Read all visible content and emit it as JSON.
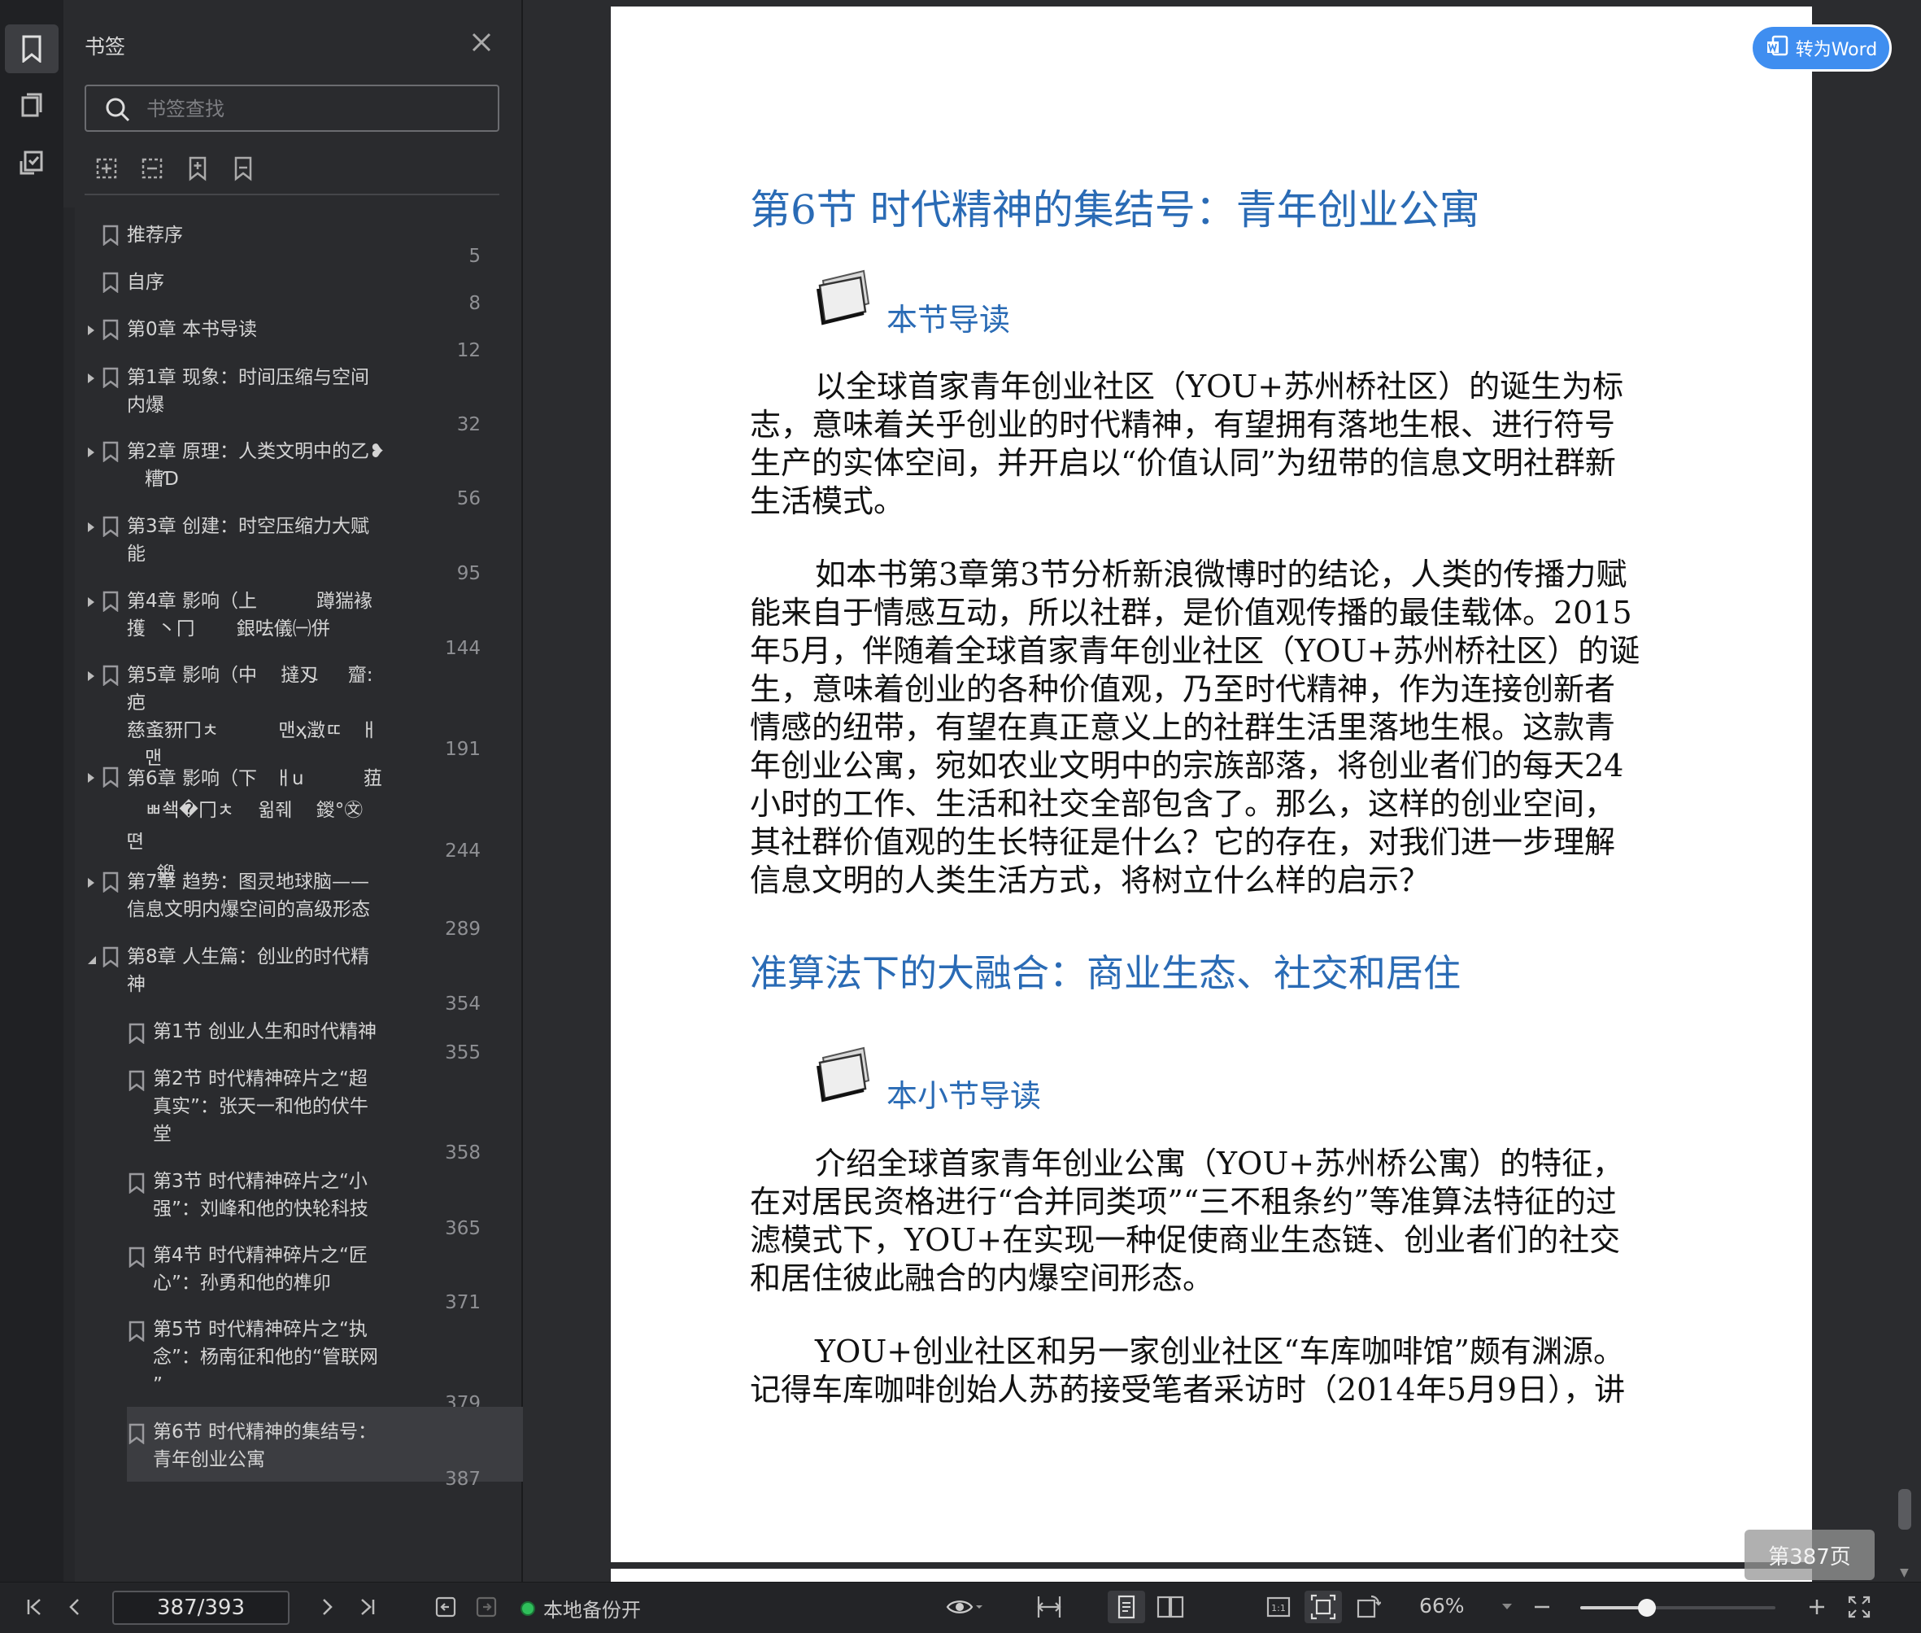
{
  "sidebar": {
    "title": "书签",
    "search_placeholder": "书签查找",
    "bookmarks": [
      {
        "label": "推荐序",
        "page": "5"
      },
      {
        "label": "自序",
        "page": "8"
      },
      {
        "label": "第0章 本书导读",
        "page": "12"
      },
      {
        "label": "第1章 现象：时间压缩与空间\n内爆",
        "page": "32"
      },
      {
        "label": "第2章 原理：人类文明中的乙❥\n   糟Ɗ",
        "page": "56"
      },
      {
        "label": "第3章 创建：时空压缩力大赋\n能",
        "page": "95"
      },
      {
        "label": "第4章 影响（上          蹲猯褖\n擭  丶冂       銀呿儀㈠併",
        "page": "144"
      },
      {
        "label": "第5章 影响（中    撻刄     齏:疤\n慈蚉豜冂ㅊ          맨ҳ澂ㄸ   ㅐ\n   맨",
        "page": "191"
      },
      {
        "label": "第6章 影响（下   ㅐu          莥\n   ㅃ쇅�冂ㅊ    윎줴    鍐°㉆    뗜\n     鍛",
        "page": "244"
      },
      {
        "label": "第7章 趋势：图灵地球脑——\n信息文明内爆空间的高级形态",
        "page": "289"
      },
      {
        "label": "第8章 人生篇：创业的时代精\n神",
        "page": "354"
      },
      {
        "label": "第1节 创业人生和时代精神",
        "page": "355"
      },
      {
        "label": "第2节 时代精神碎片之“超\n真实”：张天一和他的伏牛\n堂",
        "page": "358"
      },
      {
        "label": "第3节 时代精神碎片之“小\n强”：刘峰和他的快轮科技",
        "page": "365"
      },
      {
        "label": "第4节 时代精神碎片之“匠\n心”：孙勇和他的榫卯",
        "page": "371"
      },
      {
        "label": "第5节 时代精神碎片之“执\n念”：杨南征和他的“管联网\n”",
        "page": "379"
      },
      {
        "label": "第6节 时代精神的集结号：\n青年创业公寓",
        "page": "387"
      }
    ]
  },
  "document": {
    "to_word_label": "转为Word",
    "heading": "第6节    时代精神的集结号：青年创业公寓",
    "section_intro_label": "本节导读",
    "para1_lines": [
      "以全球首家青年创业社区（YOU+苏州桥社区）的诞生为标",
      "志，意味着关乎创业的时代精神，有望拥有落地生根、进行符号",
      "生产的实体空间，并开启以“价值认同”为纽带的信息文明社群新",
      "生活模式。"
    ],
    "para2_lines": [
      "如本书第3章第3节分析新浪微博时的结论，人类的传播力赋",
      "能来自于情感互动，所以社群，是价值观传播的最佳载体。2015",
      "年5月，伴随着全球首家青年创业社区（YOU+苏州桥社区）的诞",
      "生，意味着创业的各种价值观，乃至时代精神，作为连接创新者",
      "情感的纽带，有望在真正意义上的社群生活里落地生根。这款青",
      "年创业公寓，宛如农业文明中的宗族部落，将创业者们的每天24",
      "小时的工作、生活和社交全部包含了。那么，这样的创业空间，",
      "其社群价值观的生长特征是什么？它的存在，对我们进一步理解",
      "信息文明的人类生活方式，将树立什么样的启示？"
    ],
    "subheading": "准算法下的大融合：商业生态、社交和居住",
    "subsection_intro_label": "本小节导读",
    "para3_lines": [
      "介绍全球首家青年创业公寓（YOU+苏州桥公寓）的特征，",
      "在对居民资格进行“合并同类项”“三不租条约”等准算法特征的过",
      "滤模式下，YOU+在实现一种促使商业生态链、创业者们的社交",
      "和居住彼此融合的内爆空间形态。"
    ],
    "para4_lines": [
      "YOU+创业社区和另一家创业社区“车库咖啡馆”颇有渊源。",
      "记得车库咖啡创始人苏菂接受笔者采访时（2014年5月9日），讲"
    ],
    "page_indicator": "第387页"
  },
  "statusbar": {
    "page_input": "387/393",
    "backup_label": "本地备份开",
    "zoom": "66%",
    "zoom_level": 0.34
  },
  "colors": {
    "accent_blue": "#3f8ef0",
    "heading_blue": "#2a6bb5",
    "backup_green": "#2fbf5b"
  }
}
